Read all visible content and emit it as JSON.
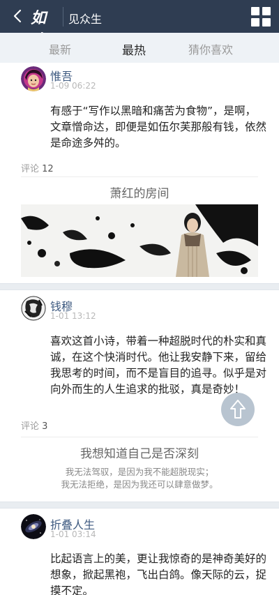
{
  "header": {
    "brand": "如也",
    "title": "见众生"
  },
  "tabs": [
    {
      "label": "最新",
      "active": false
    },
    {
      "label": "最热",
      "active": true
    },
    {
      "label": "猜你喜欢",
      "active": false
    }
  ],
  "posts": [
    {
      "author": "惟吾",
      "time": "1-09 06:22",
      "content": "有感于“写作以黑暗和痛苦为食物”，是啊，文章憎命达，即便是如伍尔芙那般有钱，依然是命途多舛的。",
      "comment_label": "评论",
      "comment_count": "12",
      "card_title": "萧红的房间"
    },
    {
      "author": "钱穆",
      "time": "1-01 13:12",
      "content": "喜欢这首小诗，带着一种超脱时代的朴实和真诚，在这个快消时代。他让我安静下来，留给我思考的时间，而不是盲目的追寻。似乎是对向外而生的人生追求的批驳，真是奇妙！",
      "comment_label": "评论",
      "comment_count": "3",
      "card_title": "我想知道自己是否深刻",
      "card_lines": [
        "我无法驾驭，是因为我不能超脱现实；",
        "我无法拒绝，是因为我还可以肆意做梦。"
      ]
    },
    {
      "author": "折叠人生",
      "time": "1-01 03:14",
      "content": "比起语言上的美，更让我惊奇的是神奇美好的想象，掀起黑袍，飞出白鸽。像天际的云，捉摸不定。"
    }
  ],
  "colors": {
    "header_bg": "#2f3d52",
    "tab_bar_bg": "#eef2f6",
    "author_color": "#3e5a80",
    "fab_bg": "#b8c4d0"
  },
  "icons": {
    "back": "chevron-left-icon",
    "menu": "grid-icon",
    "scroll_top": "upload-arrow-icon"
  }
}
